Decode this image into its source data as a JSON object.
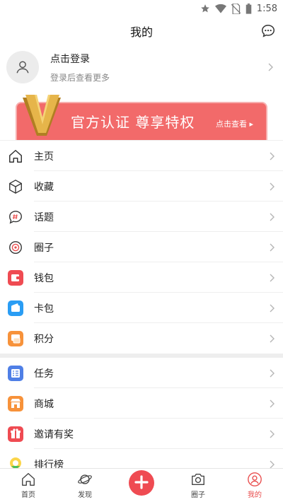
{
  "status": {
    "time": "1:58"
  },
  "header": {
    "title": "我的"
  },
  "profile": {
    "login_title": "点击登录",
    "login_sub": "登录后查看更多"
  },
  "banner": {
    "text": "官方认证 尊享特权",
    "link": "点击查看 ▸"
  },
  "menu": [
    {
      "label": "主页",
      "icon": "home-icon"
    },
    {
      "label": "收藏",
      "icon": "box-icon"
    },
    {
      "label": "话题",
      "icon": "hashtag-icon"
    },
    {
      "label": "圈子",
      "icon": "circle-icon"
    },
    {
      "label": "钱包",
      "icon": "wallet-icon"
    },
    {
      "label": "卡包",
      "icon": "card-icon"
    },
    {
      "label": "积分",
      "icon": "points-icon"
    },
    {
      "label": "任务",
      "icon": "task-icon"
    },
    {
      "label": "商城",
      "icon": "shop-icon"
    },
    {
      "label": "邀请有奖",
      "icon": "gift-icon"
    },
    {
      "label": "排行榜",
      "icon": "ranking-icon"
    }
  ],
  "tabs": [
    {
      "label": "首页"
    },
    {
      "label": "发现"
    },
    {
      "label": ""
    },
    {
      "label": "圈子"
    },
    {
      "label": "我的"
    }
  ],
  "colors": {
    "accent": "#e94e4e",
    "banner": "#f26a6a"
  }
}
